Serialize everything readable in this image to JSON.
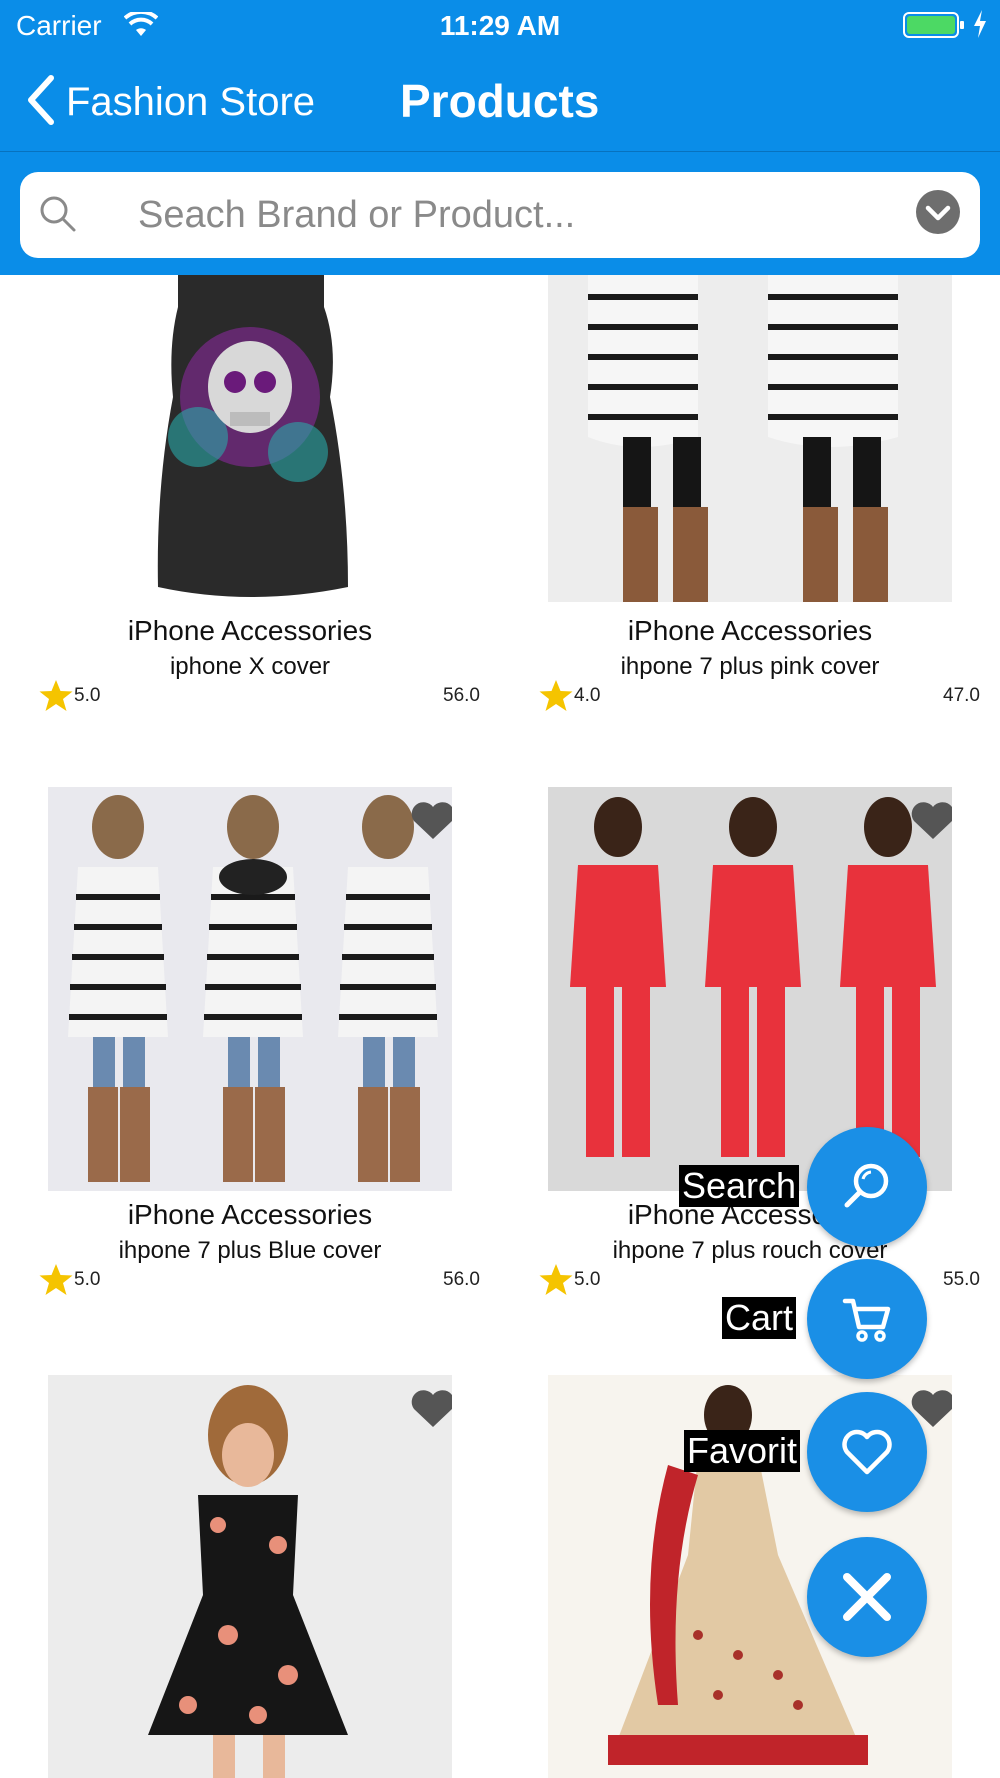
{
  "status_bar": {
    "carrier": "Carrier",
    "time": "11:29 AM"
  },
  "nav": {
    "back_label": "Fashion Store",
    "title": "Products"
  },
  "search": {
    "placeholder": "Seach Brand or Product..."
  },
  "products": [
    {
      "category": "iPhone Accessories",
      "name": "iphone X cover",
      "rating": "5.0",
      "price": "56.0"
    },
    {
      "category": "iPhone Accessories",
      "name": "ihpone 7 plus pink cover",
      "rating": "4.0",
      "price": "47.0"
    },
    {
      "category": "iPhone Accessories",
      "name": "ihpone 7 plus Blue cover",
      "rating": "5.0",
      "price": "56.0"
    },
    {
      "category": "iPhone Accessories",
      "name": "ihpone 7 plus rouch cover",
      "rating": "5.0",
      "price": "55.0"
    },
    {
      "category": "",
      "name": "",
      "rating": "",
      "price": ""
    },
    {
      "category": "",
      "name": "",
      "rating": "",
      "price": ""
    }
  ],
  "fab_menu": {
    "search_label": "Search",
    "cart_label": "Cart",
    "favorite_label": "Favorit"
  },
  "colors": {
    "header": "#0a8de8",
    "fab": "#1a8fe6",
    "star": "#f5c400",
    "heart": "#555555"
  }
}
